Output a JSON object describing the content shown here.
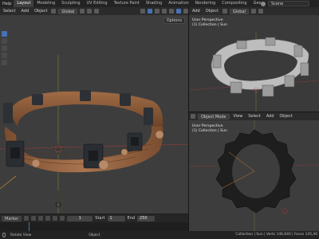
{
  "topbar": {
    "menus": [
      "Help"
    ],
    "workspaces": [
      "Layout",
      "Modeling",
      "Sculpting",
      "UV Editing",
      "Texture Paint",
      "Shading",
      "Animation",
      "Rendering",
      "Compositing",
      "Geo"
    ],
    "active_workspace": "Layout",
    "scene_label": "Scene"
  },
  "main_viewport": {
    "header": {
      "select": "Select",
      "add": "Add",
      "object": "Object",
      "orientation": "Global"
    },
    "options_label": "Options"
  },
  "top_right_viewport": {
    "header": {
      "add": "Add",
      "object": "Object",
      "orientation": "Global"
    },
    "view_title": "User Perspective",
    "collection_line": "(1) Collection | Sun"
  },
  "bottom_right_viewport": {
    "header": {
      "mode": "Object Mode",
      "view": "View",
      "select": "Select",
      "add": "Add",
      "object": "Object"
    },
    "view_title": "User Perspective",
    "collection_line": "(1) Collection | Sun"
  },
  "timeline": {
    "marker_label": "Marker",
    "current_frame": "1",
    "start_label": "Start",
    "start_value": "1",
    "end_label": "End",
    "end_value": "250"
  },
  "statusbar": {
    "left_action": "Rotate View",
    "mid_action": "Object",
    "right_info": "Collection | Sun | Verts 146,640 | Faces 145,40"
  },
  "colors": {
    "accent": "#4772b3",
    "wood": "#8a5a3a",
    "metal": "#2a2d31"
  }
}
